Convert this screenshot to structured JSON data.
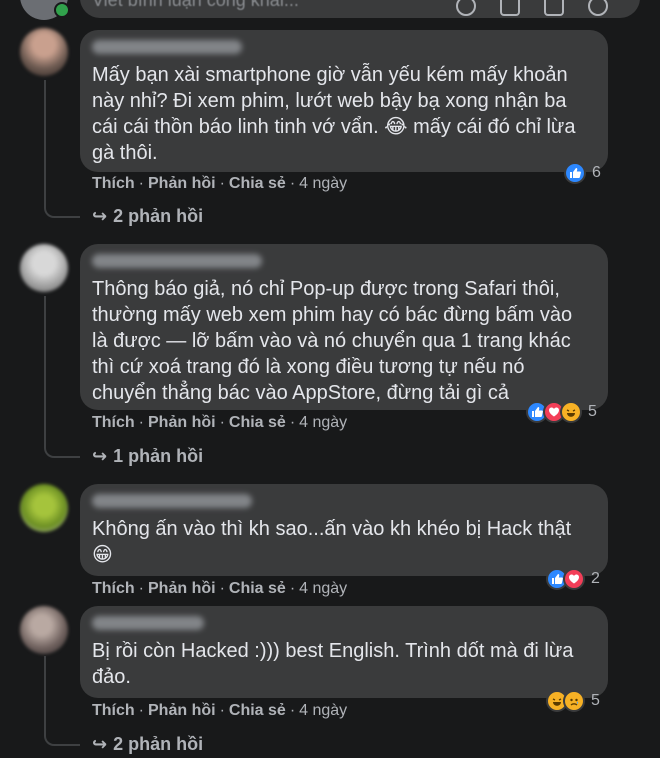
{
  "composer": {
    "placeholder": "Viết bình luận công khai..."
  },
  "comments": [
    {
      "text": "Mấy bạn xài smartphone giờ vẫn yếu kém mấy khoản này nhỉ? Đi xem phim, lướt web bậy bạ xong nhận ba cái cái thồn báo linh tinh vớ vẩn. 😂 mấy cái đó chỉ lừa gà thôi.",
      "like": "Thích",
      "reply": "Phản hồi",
      "share": "Chia sẻ",
      "time": "4 ngày",
      "reaction_count": "6",
      "reactions": [
        "like"
      ],
      "replies": "2 phản hồi"
    },
    {
      "text": "Thông báo giả, nó chỉ Pop-up được trong Safari thôi, thường mấy web xem phim hay có bác đừng bấm vào là được — lỡ bấm vào và nó chuyển qua 1 trang khác thì cứ xoá trang đó là xong điều tương tự nếu nó chuyển thẳng bác vào AppStore, đừng tải gì cả",
      "like": "Thích",
      "reply": "Phản hồi",
      "share": "Chia sẻ",
      "time": "4 ngày",
      "reaction_count": "5",
      "reactions": [
        "like",
        "love",
        "haha"
      ],
      "replies": "1 phản hồi"
    },
    {
      "text": "Không ấn vào thì kh sao...ấn vào kh khéo bị Hack thật 😁",
      "like": "Thích",
      "reply": "Phản hồi",
      "share": "Chia sẻ",
      "time": "4 ngày",
      "reaction_count": "2",
      "reactions": [
        "like",
        "love"
      ],
      "replies": ""
    },
    {
      "text": "Bị rồi còn Hacked :))) best English. Trình dốt mà đi lừa đảo.",
      "like": "Thích",
      "reply": "Phản hồi",
      "share": "Chia sẻ",
      "time": "4 ngày",
      "reaction_count": "5",
      "reactions": [
        "haha",
        "sad"
      ],
      "replies": "2 phản hồi"
    }
  ],
  "colors": {
    "background": "#18191a",
    "bubble": "#3a3b3c",
    "text": "#e4e6eb",
    "secondary": "#b0b3b8",
    "like": "#2d88ff",
    "love": "#f33e58",
    "haha": "#f7b125"
  }
}
